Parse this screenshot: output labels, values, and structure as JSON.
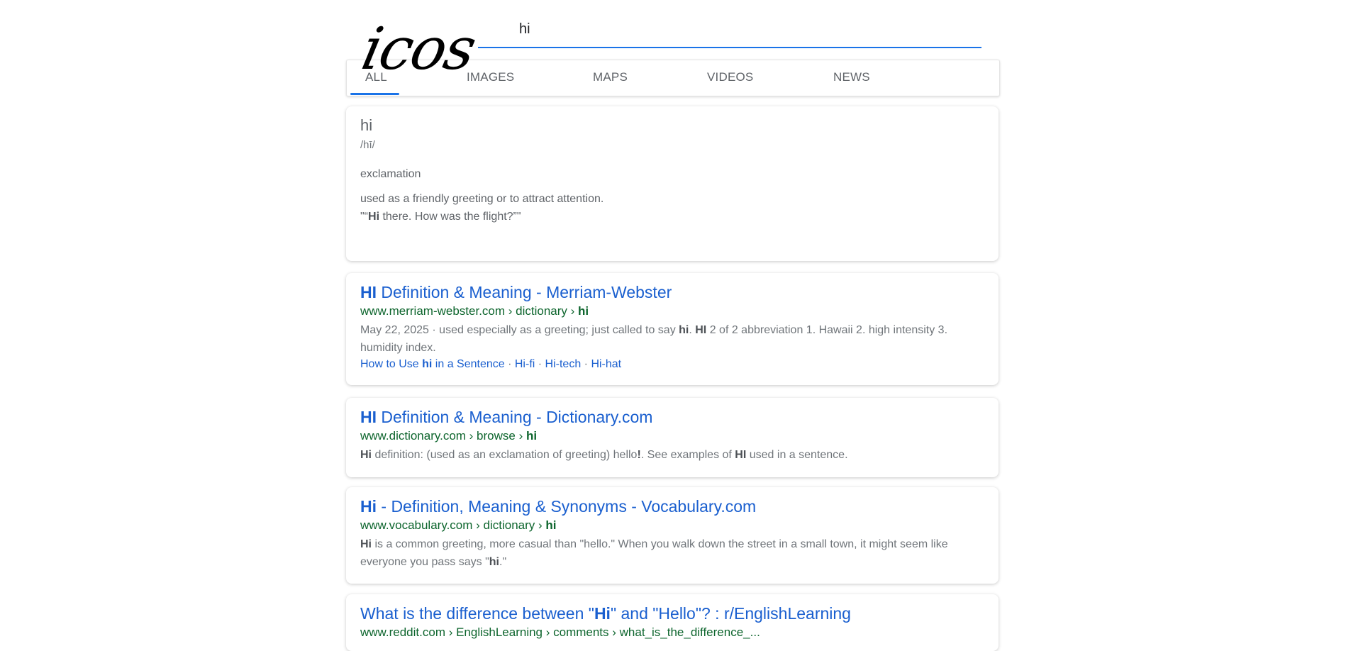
{
  "logo": {
    "text": "icos"
  },
  "search": {
    "value": "hi"
  },
  "tabs": [
    {
      "label": "ALL"
    },
    {
      "label": "IMAGES"
    },
    {
      "label": "MAPS"
    },
    {
      "label": "VIDEOS"
    },
    {
      "label": "NEWS"
    }
  ],
  "definition": {
    "word": "hi",
    "phonetic": "/hī/",
    "part_of_speech": "exclamation",
    "meaning": "used as a friendly greeting or to attract attention.",
    "example_prefix": "\"“",
    "example_bold": "Hi",
    "example_rest": " there. How was the flight?”\""
  },
  "results": [
    {
      "title_bold": "HI",
      "title_rest": " Definition & Meaning - Merriam-Webster",
      "url_prefix": "www.merriam-webster.com › dictionary › ",
      "url_bold": "hi",
      "snippet_1": "May 22, 2025 · used especially as a greeting; just called to say ",
      "snippet_b1": "hi",
      "snippet_2": ". ",
      "snippet_b2": "HI",
      "snippet_3": " 2 of 2 abbreviation 1. Hawaii 2. high intensity 3. humidity index.",
      "sitelinks": {
        "link1_prefix": "How to Use ",
        "link1_bold": "hi",
        "link1_suffix": " in a Sentence",
        "link2": "Hi-fi",
        "link3": "Hi-tech",
        "link4": "Hi-hat",
        "separator": " · "
      }
    },
    {
      "title_bold": "HI",
      "title_rest": " Definition & Meaning - Dictionary.com",
      "url_prefix": "www.dictionary.com › browse › ",
      "url_bold": "hi",
      "snippet_b1": "Hi",
      "snippet_1": " definition: (used as an exclamation of greeting) hello",
      "snippet_b2": "!",
      "snippet_2": ". See examples of ",
      "snippet_b3": "HI",
      "snippet_3": " used in a sentence."
    },
    {
      "title_bold": "Hi",
      "title_rest": " - Definition, Meaning & Synonyms - Vocabulary.com",
      "url_prefix": "www.vocabulary.com › dictionary › ",
      "url_bold": "hi",
      "snippet_b1": "Hi",
      "snippet_1": " is a common greeting, more casual than \"hello.\" When you walk down the street in a small town, it might seem like everyone you pass says \"",
      "snippet_b2": "hi",
      "snippet_2": ".\""
    },
    {
      "title_prefix": "What is the difference between \"",
      "title_bold": "Hi",
      "title_rest": "\" and \"Hello\"? : r/EnglishLearning",
      "url_prefix": "www.reddit.com › EnglishLearning › comments › what_is_the_difference_..."
    }
  ]
}
